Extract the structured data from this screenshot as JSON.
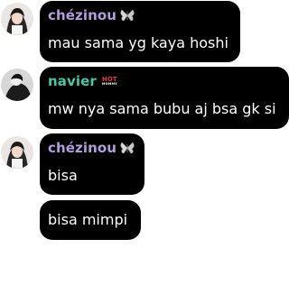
{
  "colors": {
    "bubble_bg": "#000000",
    "message_text": "#ffffff",
    "chezinou_name": "#b39ddb",
    "navier_name": "#46c6a7",
    "tag_red": "#e0373a"
  },
  "messages": [
    {
      "user": "chézinou",
      "emoji_icon": "butterfly-icon",
      "text": "mau sama yg kaya hoshi"
    },
    {
      "user": "navier",
      "tag_top": "HOT",
      "tag_bottom": "MOMMY",
      "text": "mw nya sama bubu aj bsa gk si"
    },
    {
      "user": "chézinou",
      "emoji_icon": "butterfly-icon",
      "text": "bisa",
      "followup_text": "bisa mimpi"
    }
  ]
}
